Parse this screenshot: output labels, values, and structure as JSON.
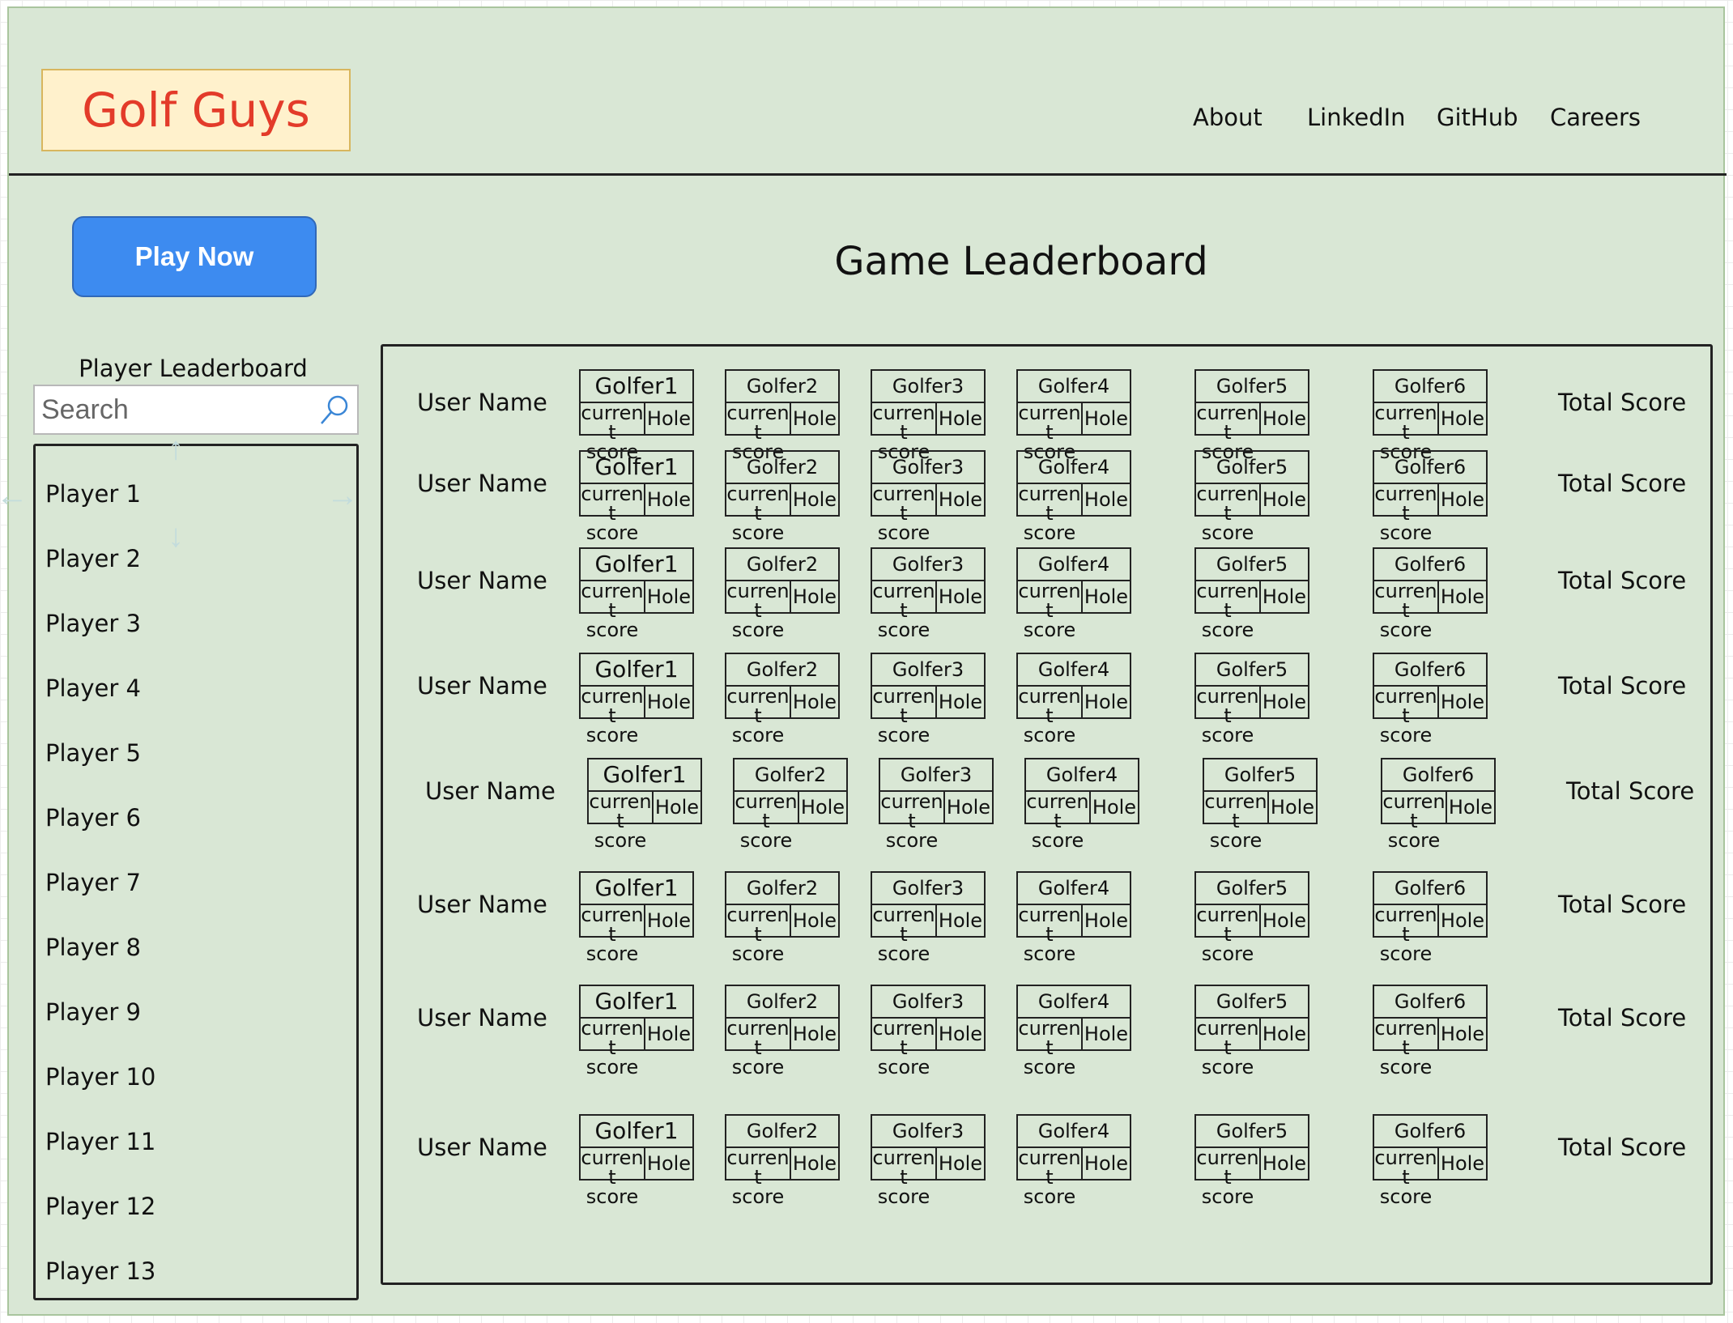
{
  "brand": {
    "logo_text": "Golf Guys"
  },
  "nav": {
    "links": [
      "About",
      "LinkedIn",
      "GitHub",
      "Careers"
    ]
  },
  "play_button": {
    "label": "Play Now"
  },
  "game_leaderboard": {
    "title": "Game Leaderboard"
  },
  "player_leaderboard": {
    "title": "Player Leaderboard",
    "search_placeholder": "Search",
    "players": [
      "Player 1",
      "Player 2",
      "Player 3",
      "Player 4",
      "Player 5",
      "Player 6",
      "Player 7",
      "Player 8",
      "Player 9",
      "Player 10",
      "Player 11",
      "Player 12",
      "Player 13"
    ]
  },
  "board": {
    "rows": [
      {
        "user": "User Name",
        "total": "Total Score"
      },
      {
        "user": "User Name",
        "total": "Total Score"
      },
      {
        "user": "User Name",
        "total": "Total Score"
      },
      {
        "user": "User Name",
        "total": "Total Score"
      },
      {
        "user": "User Name",
        "total": "Total Score"
      },
      {
        "user": "User Name",
        "total": "Total Score"
      },
      {
        "user": "User Name",
        "total": "Total Score"
      },
      {
        "user": "User Name",
        "total": "Total Score"
      }
    ],
    "golfers": [
      "Golfer1",
      "Golfer2",
      "Golfer3",
      "Golfer4",
      "Golfer5",
      "Golfer6"
    ],
    "score_label": "current score",
    "hole_label": "Hole"
  },
  "colors": {
    "page_bg": "#d9e7d5",
    "logo_bg": "#fff1cc",
    "logo_text": "#e33b2a",
    "play_button_bg": "#3d8bf0"
  }
}
